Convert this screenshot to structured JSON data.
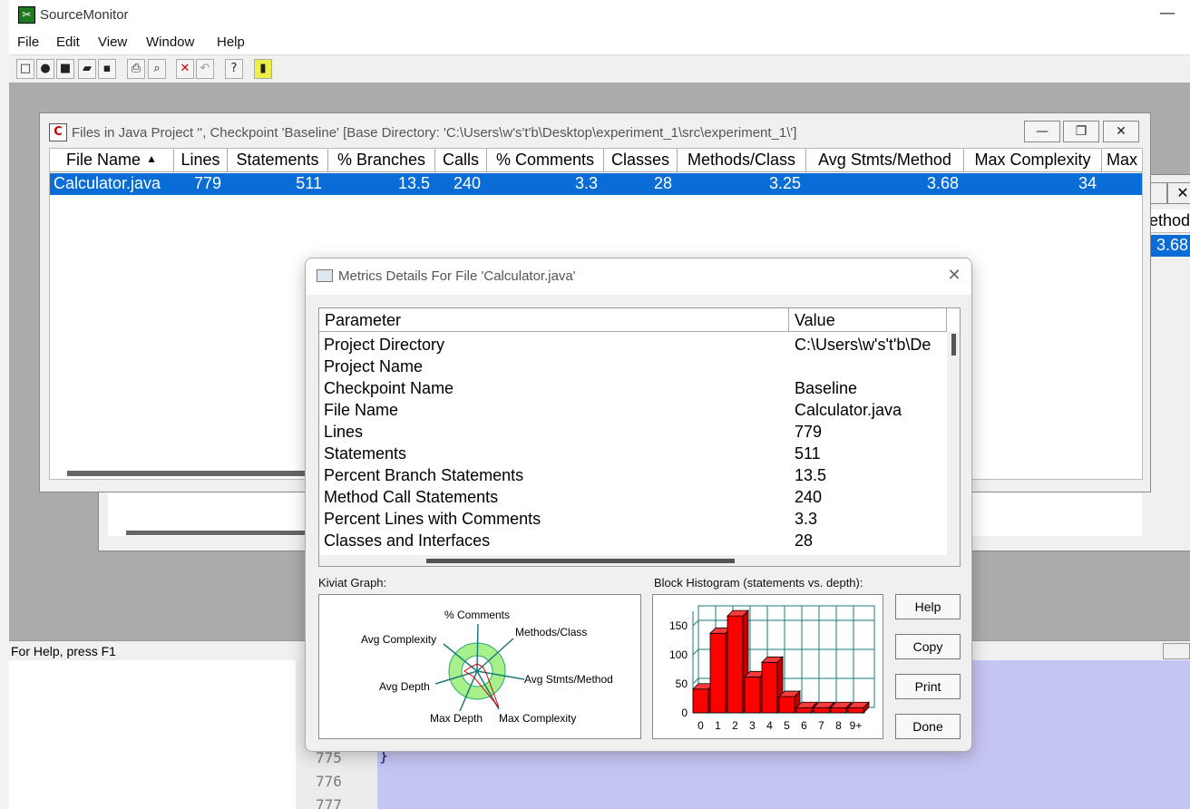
{
  "app": {
    "title": "SourceMonitor",
    "menu": [
      "File",
      "Edit",
      "View",
      "Window",
      "Help"
    ],
    "status": "For Help, press F1"
  },
  "toolbar": {
    "icons": [
      "new-icon",
      "open-project-icon",
      "close-project-icon",
      "open-folder-icon",
      "save-icon",
      "print-icon",
      "print-preview-icon",
      "delete-icon",
      "undo-icon",
      "context-help-icon",
      "about-icon"
    ]
  },
  "file_window": {
    "title": "Files in Java Project '', Checkpoint 'Baseline'  [Base Directory: 'C:\\Users\\w's't'b\\Desktop\\experiment_1\\src\\experiment_1\\']",
    "columns": [
      "File Name",
      "Lines",
      "Statements",
      "% Branches",
      "Calls",
      "% Comments",
      "Classes",
      "Methods/Class",
      "Avg Stmts/Method",
      "Max Complexity",
      "Max"
    ],
    "row": [
      "Calculator.java",
      "779",
      "511",
      "13.5",
      "240",
      "3.3",
      "28",
      "3.25",
      "3.68",
      "34",
      ""
    ]
  },
  "back_window": {
    "header_fragment": "ethod",
    "value_fragment": "3.68"
  },
  "dialog": {
    "title": "Metrics Details For File 'Calculator.java'",
    "param_header": "Parameter",
    "value_header": "Value",
    "metrics": [
      {
        "p": "Project Directory",
        "v": "C:\\Users\\w's't'b\\De"
      },
      {
        "p": "Project Name",
        "v": ""
      },
      {
        "p": "Checkpoint Name",
        "v": "Baseline"
      },
      {
        "p": "File Name",
        "v": "Calculator.java"
      },
      {
        "p": "Lines",
        "v": "779"
      },
      {
        "p": "Statements",
        "v": "511"
      },
      {
        "p": "Percent Branch Statements",
        "v": "13.5"
      },
      {
        "p": "Method Call Statements",
        "v": "240"
      },
      {
        "p": "Percent Lines with Comments",
        "v": "3.3"
      },
      {
        "p": "Classes and Interfaces",
        "v": "28"
      }
    ],
    "kiviat_label": "Kiviat Graph:",
    "histogram_label": "Block Histogram (statements vs. depth):",
    "kiviat_axes": [
      "% Comments",
      "Methods/Class",
      "Avg Stmts/Method",
      "Max Complexity",
      "Max Depth",
      "Avg Depth",
      "Avg Complexity"
    ],
    "buttons": {
      "help": "Help",
      "copy": "Copy",
      "print": "Print",
      "done": "Done"
    }
  },
  "chart_data": {
    "type": "bar",
    "title": "Block Histogram (statements vs. depth):",
    "categories": [
      "0",
      "1",
      "2",
      "3",
      "4",
      "5",
      "6",
      "7",
      "8",
      "9+"
    ],
    "values": [
      41,
      137,
      167,
      62,
      87,
      28,
      9,
      9,
      9,
      9
    ],
    "yticks": [
      "0",
      "50",
      "100",
      "150"
    ],
    "ylim": [
      0,
      175
    ],
    "grid": true,
    "bar_color": "#ff0000"
  },
  "editor": {
    "line_numbers": [
      "775",
      "776",
      "777"
    ],
    "brace": "}"
  }
}
